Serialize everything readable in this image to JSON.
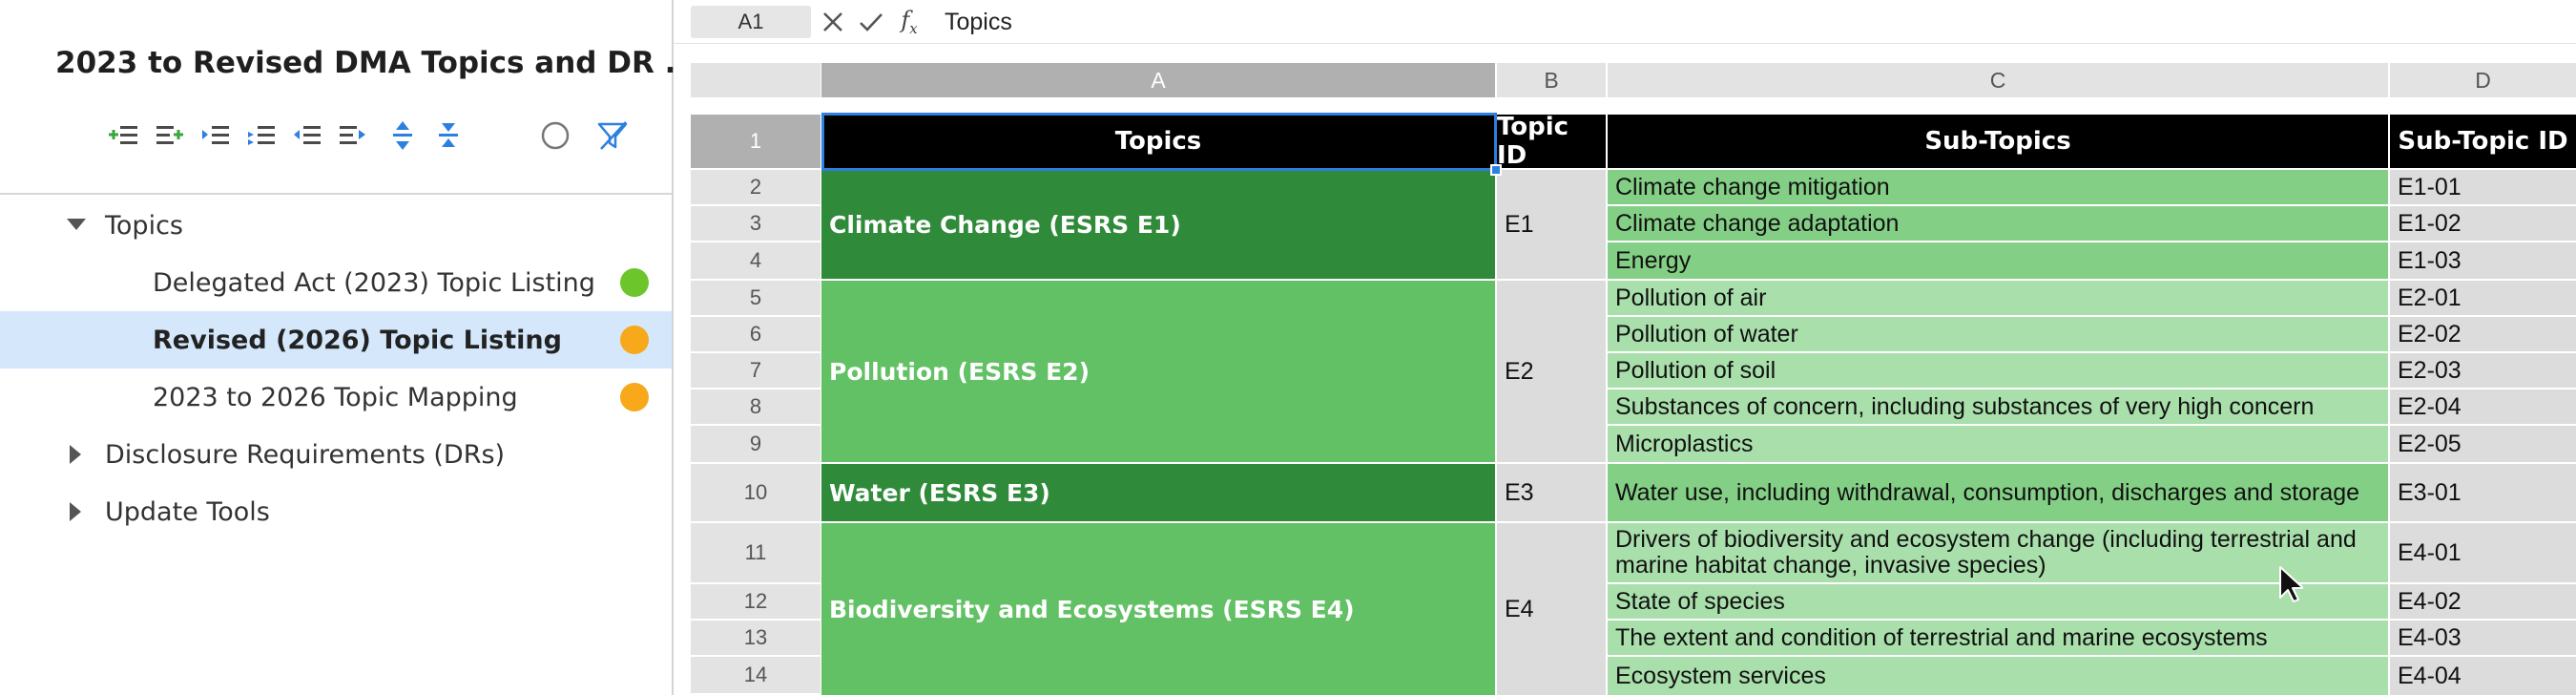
{
  "sidebar": {
    "title": "2023 to Revised DMA Topics and DR ...",
    "toolbar": [
      {
        "icon": "add-row-above-icon"
      },
      {
        "icon": "add-row-below-icon"
      },
      {
        "icon": "indent-icon"
      },
      {
        "icon": "indent-more-icon"
      },
      {
        "icon": "outdent-icon"
      },
      {
        "icon": "outdent-more-icon"
      },
      {
        "icon": "expand-icon"
      },
      {
        "icon": "collapse-icon"
      },
      {
        "icon": "circle-icon"
      },
      {
        "icon": "filter-off-icon"
      }
    ],
    "tree": {
      "topics_label": "Topics",
      "items": [
        {
          "label": "Delegated Act (2023) Topic Listing",
          "status_color": "#6cc52a"
        },
        {
          "label": "Revised (2026) Topic Listing",
          "status_color": "#f7a81b"
        },
        {
          "label": "2023 to 2026 Topic Mapping",
          "status_color": "#f7a81b"
        }
      ],
      "disclosure_label": "Disclosure Requirements (DRs)",
      "update_tools_label": "Update Tools"
    }
  },
  "formula_bar": {
    "cell_ref": "A1",
    "value": "Topics"
  },
  "columns": [
    "A",
    "B",
    "C",
    "D"
  ],
  "rows": [
    "1",
    "2",
    "3",
    "4",
    "5",
    "6",
    "7",
    "8",
    "9",
    "10",
    "11",
    "12",
    "13",
    "14"
  ],
  "header": {
    "topics": "Topics",
    "topic_id": "Topic ID",
    "sub_topics": "Sub-Topics",
    "sub_topic_id": "Sub-Topic ID"
  },
  "topics": [
    {
      "name": "Climate Change (ESRS E1)",
      "id": "E1"
    },
    {
      "name": "Pollution (ESRS E2)",
      "id": "E2"
    },
    {
      "name": "Water (ESRS E3)",
      "id": "E3"
    },
    {
      "name": "Biodiversity and Ecosystems (ESRS E4)",
      "id": "E4"
    }
  ],
  "subtopics": [
    {
      "name": "Climate change mitigation",
      "id": "E1-01"
    },
    {
      "name": "Climate change adaptation",
      "id": "E1-02"
    },
    {
      "name": "Energy",
      "id": "E1-03"
    },
    {
      "name": "Pollution of air",
      "id": "E2-01"
    },
    {
      "name": "Pollution of water",
      "id": "E2-02"
    },
    {
      "name": "Pollution of soil",
      "id": "E2-03"
    },
    {
      "name": "Substances of concern, including substances of very high concern",
      "id": "E2-04"
    },
    {
      "name": "Microplastics",
      "id": "E2-05"
    },
    {
      "name": "Water use, including withdrawal, consumption, discharges and storage",
      "id": "E3-01"
    },
    {
      "name": "Drivers of biodiversity and ecosystem change (including terrestrial and marine habitat change, invasive species)",
      "id": "E4-01"
    },
    {
      "name": "State of species",
      "id": "E4-02"
    },
    {
      "name": "The extent and condition of terrestrial and marine ecosystems",
      "id": "E4-03"
    },
    {
      "name": "Ecosystem services",
      "id": "E4-04"
    }
  ],
  "colors": {
    "header_bg": "#000000",
    "topic_dark": "#2f8a3a",
    "topic_light": "#62c065",
    "subtopic_dark": "#84cf86",
    "subtopic_light": "#a9dfab",
    "selection": "#2d7fe0"
  }
}
